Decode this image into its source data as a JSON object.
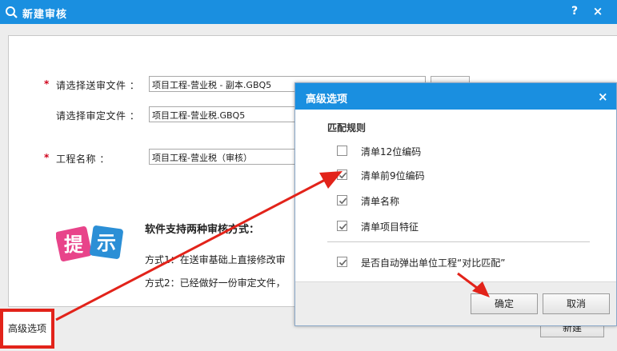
{
  "window": {
    "title": "新建审核",
    "help_label": "?",
    "close_label": "×"
  },
  "form": {
    "send_file_label": "请选择送审文件 ：",
    "send_file_value": "项目工程-营业税 - 副本.GBQ5",
    "approved_file_label": "请选择审定文件 ：",
    "approved_file_value": "项目工程-营业税.GBQ5",
    "project_name_label": "工程名称 ：",
    "project_name_value": "项目工程-营业税（审核）",
    "required_mark": "*"
  },
  "tip": {
    "logo_chars": [
      "提",
      "示"
    ],
    "title": "软件支持两种审核方式：",
    "line1": "方式1：在送审基础上直接修改审",
    "line2": "方式2：已经做好一份审定文件，"
  },
  "buttons": {
    "advanced_label": "高级选项",
    "new_label": "新建"
  },
  "dialog": {
    "title": "高级选项",
    "close_label": "×",
    "group_label": "匹配规则",
    "options": [
      {
        "label": "清单12位编码",
        "checked": false
      },
      {
        "label": "清单前9位编码",
        "checked": true
      },
      {
        "label": "清单名称",
        "checked": true
      },
      {
        "label": "清单项目特征",
        "checked": true
      }
    ],
    "auto_popup": {
      "label": "是否自动弹出单位工程“对比匹配”",
      "checked": true
    },
    "ok_label": "确定",
    "cancel_label": "取消"
  },
  "colors": {
    "titlebar": "#1a8fe0",
    "annotation": "#e2231a"
  }
}
